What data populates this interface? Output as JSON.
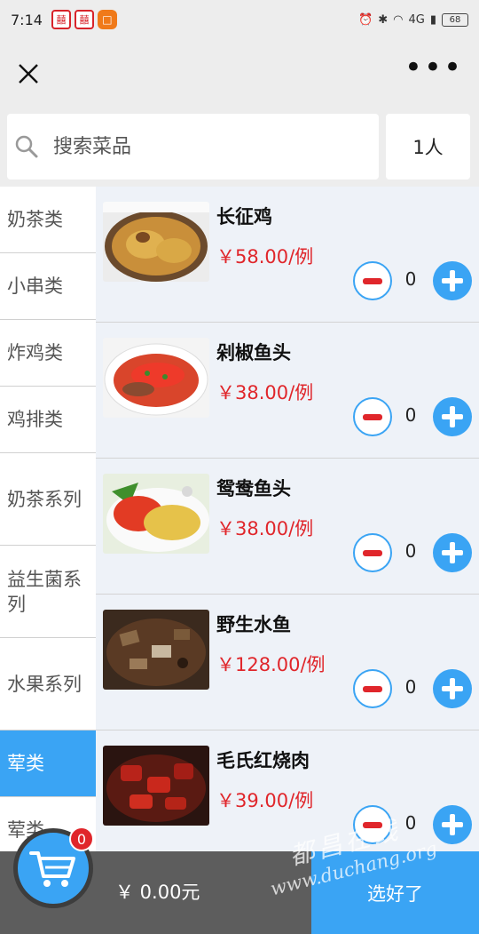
{
  "status_bar": {
    "time": "7:14",
    "network": "4G",
    "battery": "68"
  },
  "search": {
    "placeholder": "搜索菜品",
    "people_label": "1人"
  },
  "categories": [
    {
      "label": "奶茶类",
      "active": false
    },
    {
      "label": "小串类",
      "active": false
    },
    {
      "label": "炸鸡类",
      "active": false
    },
    {
      "label": "鸡排类",
      "active": false
    },
    {
      "label": "奶茶系列",
      "active": false
    },
    {
      "label": "益生菌系列",
      "active": false
    },
    {
      "label": "水果系列",
      "active": false
    },
    {
      "label": "荤类",
      "active": true
    },
    {
      "label": "荤类",
      "active": false
    }
  ],
  "dishes": [
    {
      "name": "长征鸡",
      "price": "￥58.00/例",
      "qty": "0",
      "image": "stewed-chicken"
    },
    {
      "name": "剁椒鱼头",
      "price": "￥38.00/例",
      "qty": "0",
      "image": "chopped-pepper-fish-head"
    },
    {
      "name": "鸳鸯鱼头",
      "price": "￥38.00/例",
      "qty": "0",
      "image": "double-flavor-fish-head"
    },
    {
      "name": "野生水鱼",
      "price": "￥128.00/例",
      "qty": "0",
      "image": "wild-soft-shell-turtle"
    },
    {
      "name": "毛氏红烧肉",
      "price": "￥39.00/例",
      "qty": "0",
      "image": "braised-pork"
    }
  ],
  "cart": {
    "count": "0",
    "total": "￥ 0.00元",
    "checkout_label": "选好了"
  },
  "watermark": {
    "line1": "都昌在线",
    "line2": "www.duchang.org"
  },
  "colors": {
    "accent": "#3aa4f4",
    "price": "#e0262b",
    "bottom_bar": "#5d5d5d"
  }
}
